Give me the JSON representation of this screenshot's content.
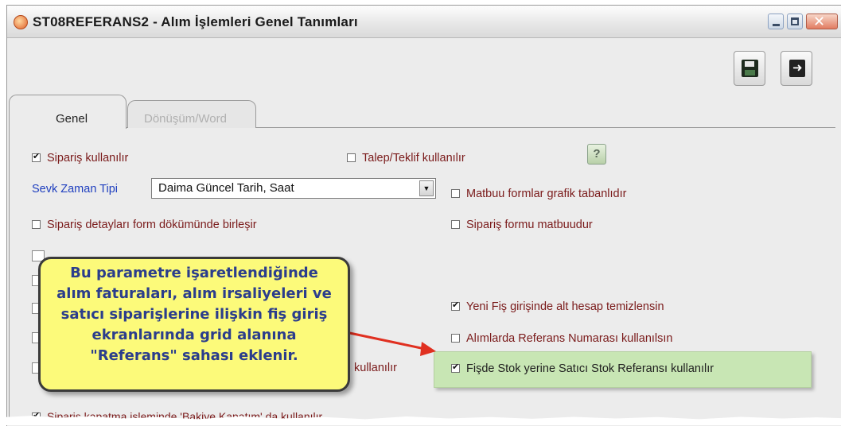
{
  "window": {
    "title": "ST08REFERANS2 - Alım İşlemleri Genel Tanımları",
    "app_icon": "app-logo-icon"
  },
  "toolbar": {
    "save_icon": "save-icon",
    "exit_icon": "exit-icon"
  },
  "tabs": [
    {
      "label": "Genel",
      "active": true
    },
    {
      "label": "Dönüşüm/Word",
      "active": false
    }
  ],
  "options": {
    "siparis_kullanilir": {
      "label": "Sipariş kullanılır",
      "checked": true
    },
    "talep_teklif": {
      "label": "Talep/Teklif kullanılır",
      "checked": false
    },
    "help_label": "?",
    "sevk_zaman_tipi": {
      "label": "Sevk Zaman Tipi",
      "value": "Daima Güncel Tarih, Saat"
    },
    "matbuu_grafik": {
      "label": "Matbuu formlar grafik tabanlıdır",
      "checked": false
    },
    "siparis_detay_birlesir": {
      "label": "Sipariş detayları form dökümünde birleşir",
      "checked": false
    },
    "siparis_formu_matbuu": {
      "label": "Sipariş formu matbuudur",
      "checked": false
    },
    "yeni_fis_alt_hesap": {
      "label": "Yeni Fiş girişinde alt hesap temizlensin",
      "checked": true
    },
    "alim_referans_no": {
      "label": "Alımlarda Referans Numarası kullanılsın",
      "checked": false
    },
    "partial_label": "kullanılır",
    "fisde_stok_referans": {
      "label": "Fişde Stok yerine Satıcı Stok Referansı kullanılır",
      "checked": true
    },
    "siparis_kapatma": {
      "label": "Sipariş kapatma işleminde 'Bakiye Kapatım' da kullanılır",
      "checked": true
    }
  },
  "callout": {
    "lines": [
      "Bu parametre işaretlendiğinde",
      "alım faturaları, alım irsaliyeleri ve",
      "satıcı siparişlerine ilişkin fiş giriş",
      "ekranlarında grid alanına",
      "\"Referans\" sahası eklenir."
    ]
  },
  "colors": {
    "callout_bg": "#fcfa7a",
    "callout_text": "#2b3d8c",
    "highlight_bg": "#c8e6b4",
    "arrow": "#e03020",
    "option_text": "#7a1a1a",
    "label_blue": "#1f3fbf"
  }
}
